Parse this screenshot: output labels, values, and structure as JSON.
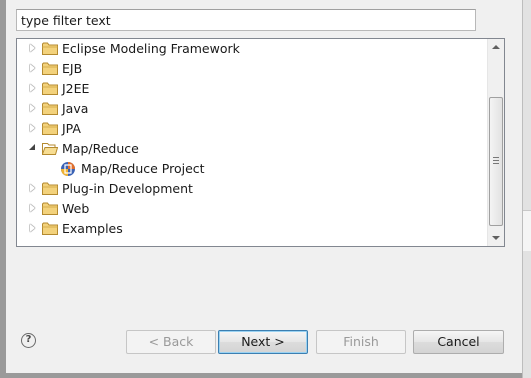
{
  "filter": {
    "placeholder": "type filter text",
    "value": "type filter text"
  },
  "tree": {
    "items": [
      {
        "label": "Eclipse Modeling Framework",
        "expanded": false,
        "icon": "folder-icon"
      },
      {
        "label": "EJB",
        "expanded": false,
        "icon": "folder-icon"
      },
      {
        "label": "J2EE",
        "expanded": false,
        "icon": "folder-icon"
      },
      {
        "label": "Java",
        "expanded": false,
        "icon": "folder-icon"
      },
      {
        "label": "JPA",
        "expanded": false,
        "icon": "folder-icon"
      },
      {
        "label": "Map/Reduce",
        "expanded": true,
        "icon": "folder-open-icon"
      },
      {
        "label": "Map/Reduce Project",
        "child": true,
        "icon": "mapreduce-project-icon"
      },
      {
        "label": "Plug-in Development",
        "expanded": false,
        "icon": "folder-icon"
      },
      {
        "label": "Web",
        "expanded": false,
        "icon": "folder-icon"
      },
      {
        "label": "Examples",
        "expanded": false,
        "icon": "folder-icon"
      }
    ]
  },
  "buttons": {
    "back": "< Back",
    "next": "Next >",
    "finish": "Finish",
    "cancel": "Cancel"
  },
  "help": {
    "glyph": "?"
  },
  "colors": {
    "folder": "#e9c46a",
    "default_button_border": "#3c7fb1"
  }
}
